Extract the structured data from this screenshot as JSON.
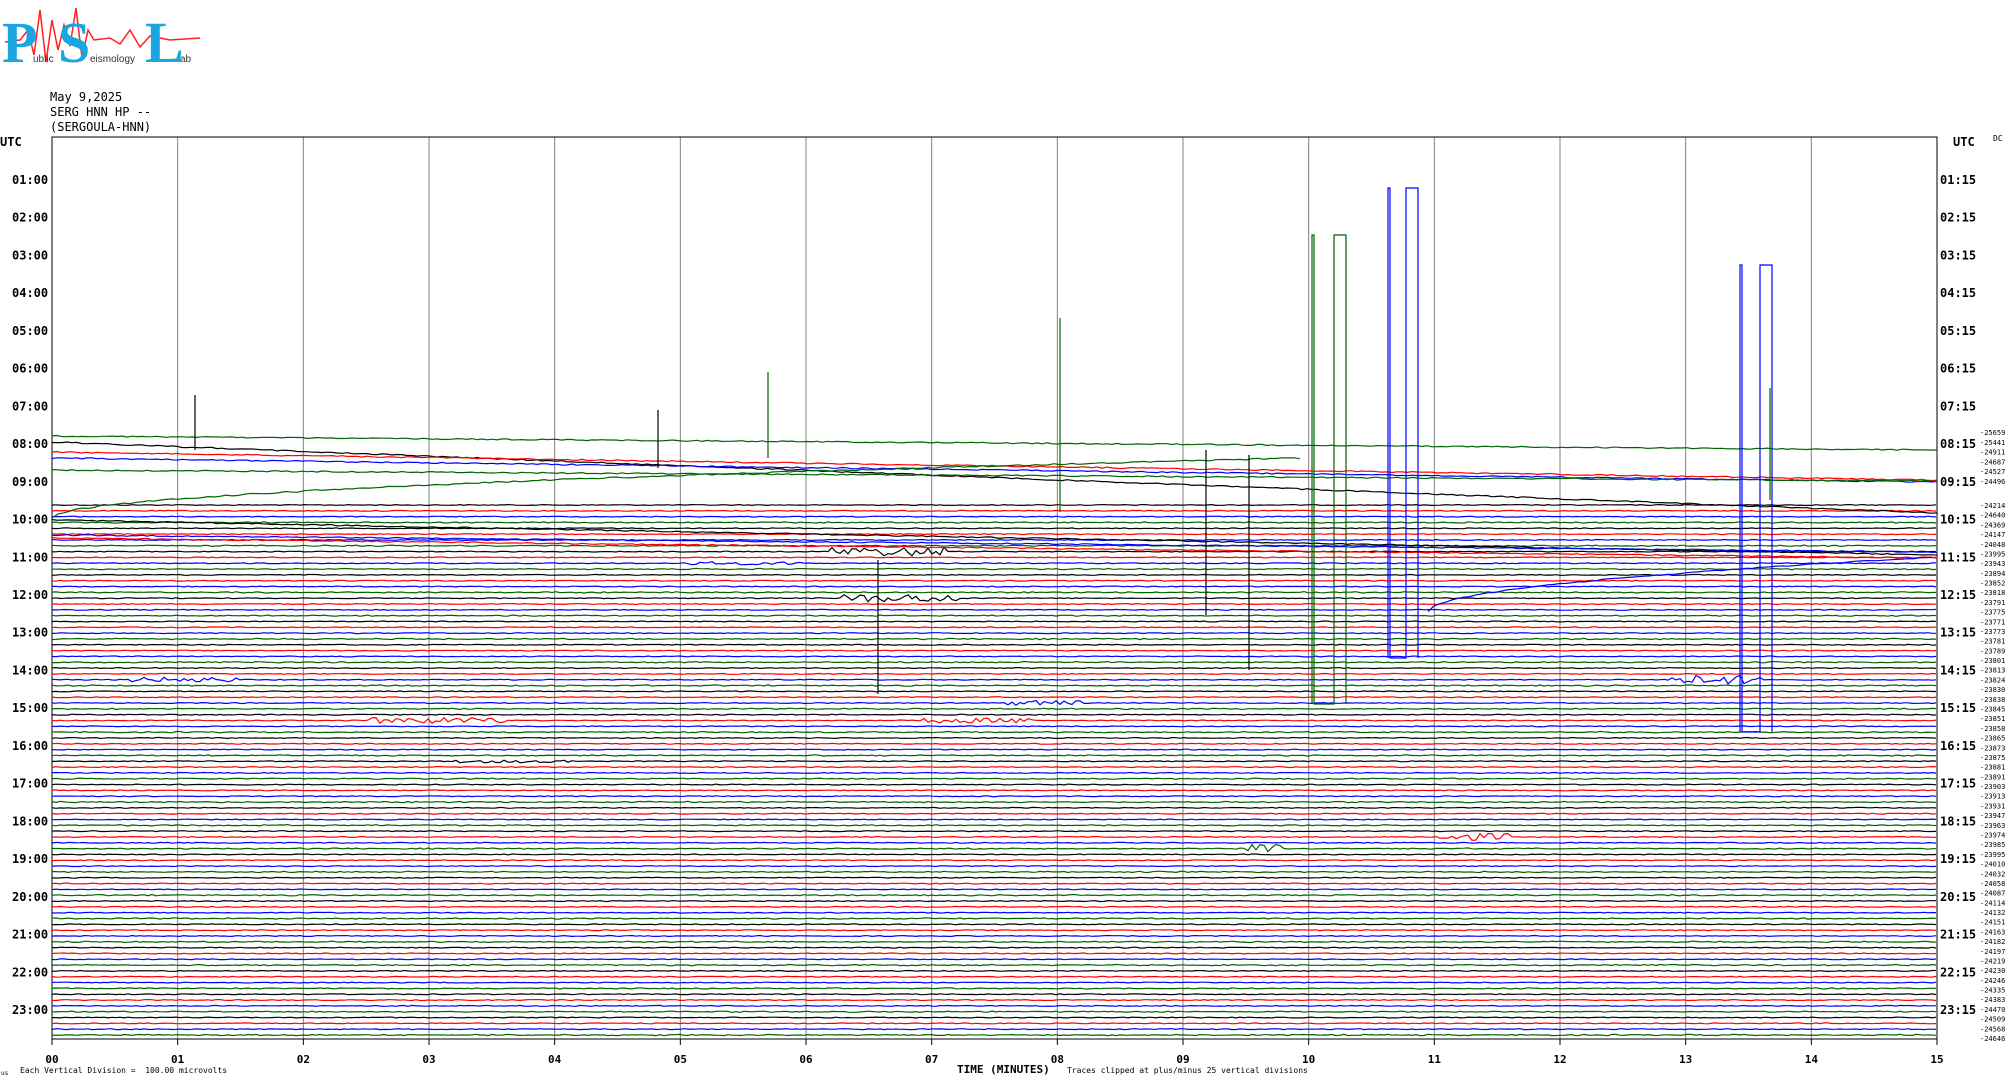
{
  "logo": {
    "letters": [
      "P",
      "S",
      "L"
    ],
    "words": [
      "ublic",
      "eismology",
      "ab"
    ]
  },
  "header": {
    "date": "May 9,2025",
    "station": "SERG HNN HP --",
    "station_name": "(SERGOULA-HNN)"
  },
  "left_axis_title": "UTC",
  "right_axis_title": "UTC",
  "dc_label": "DC",
  "footer": {
    "left_note": "Each Vertical Division =  100.00 microvolts",
    "corner_mark": "us",
    "xlabel": "TIME (MINUTES)",
    "clip_note": "Traces clipped at plus/minus 25 vertical divisions"
  },
  "colors": {
    "black": "#000000",
    "red": "#ff0000",
    "blue": "#0000ff",
    "green": "#006400",
    "grid": "#808080"
  },
  "chart_data": {
    "type": "line",
    "xlabel": "TIME (MINUTES)",
    "xlim": [
      0,
      15
    ],
    "x_ticks": [
      "00",
      "01",
      "02",
      "03",
      "04",
      "05",
      "06",
      "07",
      "08",
      "09",
      "10",
      "11",
      "12",
      "13",
      "14",
      "15"
    ],
    "hours_left": [
      "01:00",
      "02:00",
      "03:00",
      "04:00",
      "05:00",
      "06:00",
      "07:00",
      "08:00",
      "09:00",
      "10:00",
      "11:00",
      "12:00",
      "13:00",
      "14:00",
      "15:00",
      "16:00",
      "17:00",
      "18:00",
      "19:00",
      "20:00",
      "21:00",
      "22:00",
      "23:00"
    ],
    "hours_right": [
      "01:15",
      "02:15",
      "03:15",
      "04:15",
      "05:15",
      "06:15",
      "07:15",
      "08:15",
      "09:15",
      "10:15",
      "11:15",
      "12:15",
      "13:15",
      "14:15",
      "15:15",
      "16:15",
      "17:15",
      "18:15",
      "19:15",
      "20:15",
      "21:15",
      "22:15",
      "23:15"
    ],
    "trace_colors": [
      "black",
      "red",
      "blue",
      "green"
    ],
    "dc_offsets": [
      "-25659",
      "-25441",
      "-24911",
      "-24687",
      "-24527",
      "-24496",
      "-24214",
      "-24640",
      "-24369",
      "-24147",
      "-24048",
      "-23995",
      "-23943",
      "-23894",
      "-23852",
      "-23818",
      "-23791",
      "-23775",
      "-23771",
      "-23773",
      "-23781",
      "-23789",
      "-23801",
      "-23813",
      "-23824",
      "-23830",
      "-23838",
      "-23845",
      "-23851",
      "-23858",
      "-23865",
      "-23873",
      "-23875",
      "-23881",
      "-23891",
      "-23903",
      "-23913",
      "-23931",
      "-23947",
      "-23963",
      "-23974",
      "-23985",
      "-23995",
      "-24010",
      "-24032",
      "-24058",
      "-24087",
      "-24114",
      "-24132",
      "-24151",
      "-24163",
      "-24182",
      "-24197",
      "-24219",
      "-24230",
      "-24246",
      "-24335",
      "-24383",
      "-24470",
      "-24509",
      "-24568",
      "-24646"
    ]
  }
}
